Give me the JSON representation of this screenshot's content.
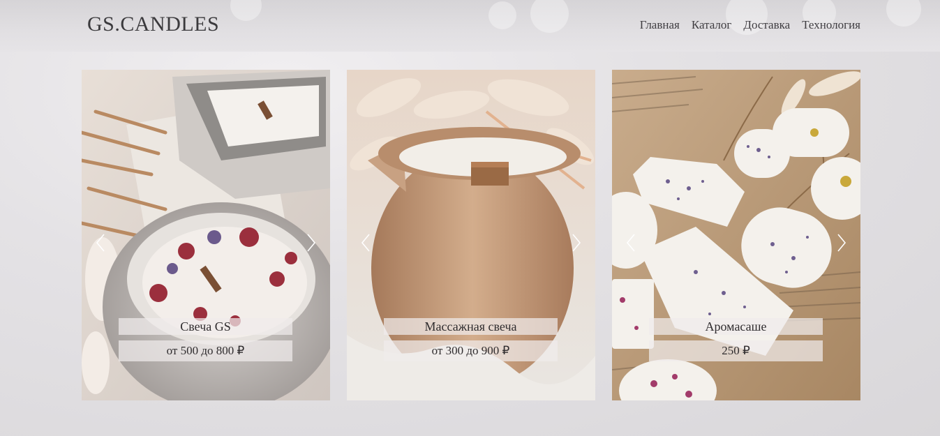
{
  "brand": {
    "name": "GS.CANDLES"
  },
  "nav": {
    "items": [
      {
        "label": "Главная"
      },
      {
        "label": "Каталог"
      },
      {
        "label": "Доставка"
      },
      {
        "label": "Технология"
      }
    ]
  },
  "products": [
    {
      "name": "Свеча GS",
      "price": "от 500 до 800 ₽",
      "image": "concrete-bowl-candle-with-dried-petals"
    },
    {
      "name": "Массажная свеча",
      "price": "от 300 до 900 ₽",
      "image": "clay-pitcher-massage-candle"
    },
    {
      "name": "Аромасаше",
      "price": "250 ₽",
      "image": "wax-sachets-with-lavender"
    }
  ],
  "icons": {
    "prev": "chevron-left-icon",
    "next": "chevron-right-icon"
  },
  "colors": {
    "text": "#3b3a3d",
    "label_bg": "#f0ecec"
  }
}
